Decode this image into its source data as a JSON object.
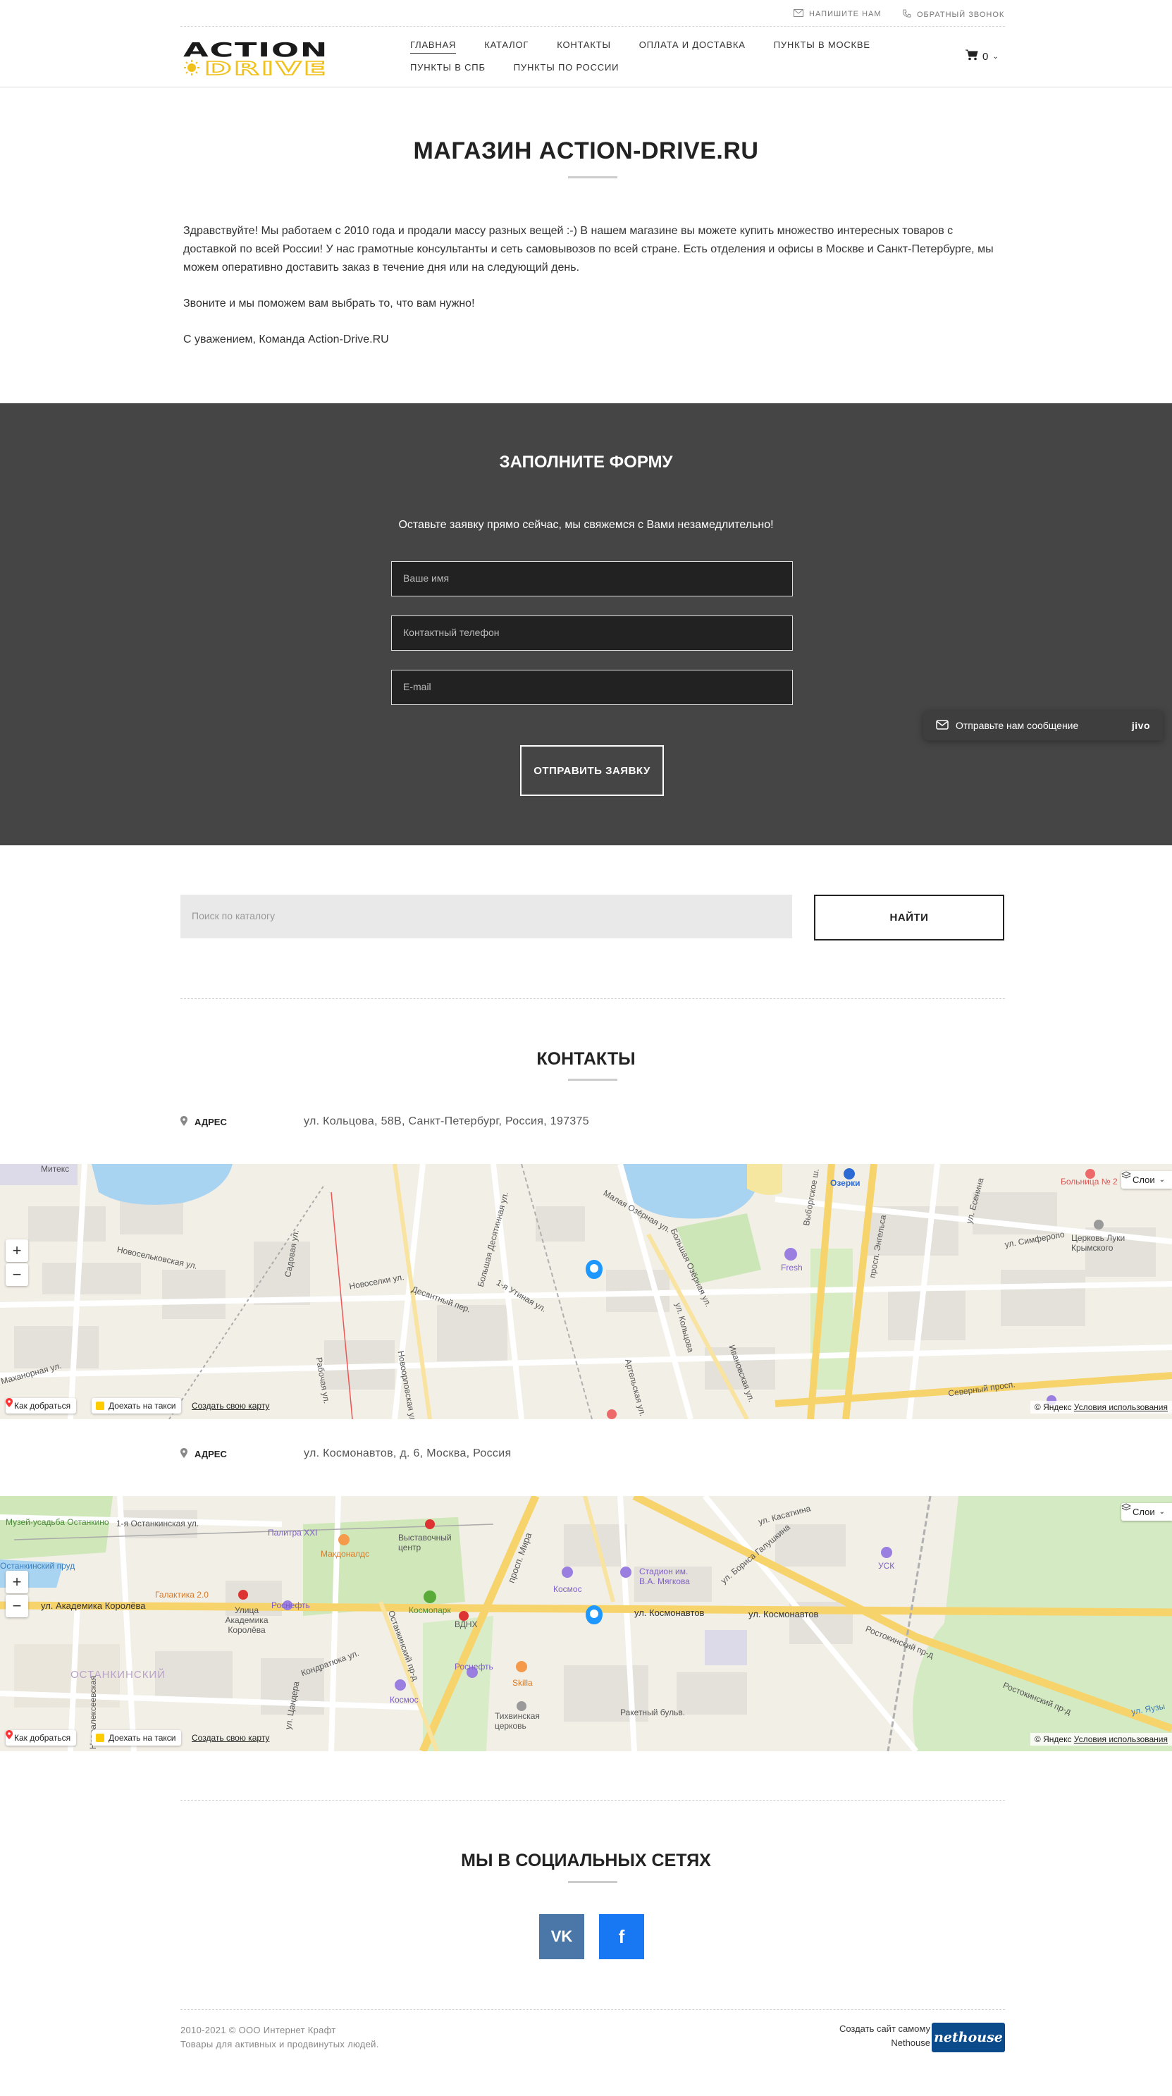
{
  "top_links": {
    "write_us": "НАПИШИТЕ НАМ",
    "callback": "ОБРАТНЫЙ ЗВОНОК"
  },
  "logo": {
    "line1": "ACTION",
    "line2": "DRIVE"
  },
  "nav": [
    {
      "label": "ГЛАВНАЯ",
      "active": true
    },
    {
      "label": "КАТАЛОГ"
    },
    {
      "label": "КОНТАКТЫ"
    },
    {
      "label": "ОПЛАТА И ДОСТАВКА"
    },
    {
      "label": "ПУНКТЫ В МОСКВЕ"
    },
    {
      "label": "ПУНКТЫ В СПБ"
    },
    {
      "label": "ПУНКТЫ ПО РОССИИ"
    }
  ],
  "cart": {
    "count": "0"
  },
  "store": {
    "title": "МАГАЗИН ACTION-DRIVE.RU",
    "paragraphs": [
      "Здравствуйте! Мы работаем с 2010 года и продали массу разных вещей :-) В нашем магазине вы можете купить множество интересных товаров с доставкой по всей России! У нас грамотные консультанты и сеть самовывозов по всей стране. Есть отделения и офисы в Москве и Санкт-Петербурге, мы можем оперативно доставить заказ в течение дня или на следующий день.",
      "Звоните и мы поможем вам выбрать то, что вам нужно!",
      "С уважением, Команда Action-Drive.RU"
    ]
  },
  "form": {
    "title": "ЗАПОЛНИТЕ ФОРМУ",
    "subtitle": "Оставьте заявку прямо сейчас, мы свяжемся с Вами незамедлительно!",
    "name_placeholder": "Ваше имя",
    "phone_placeholder": "Контактный телефон",
    "email_placeholder": "E-mail",
    "submit": "ОТПРАВИТЬ ЗАЯВКУ"
  },
  "chat_widget": {
    "text": "Отправьте нам сообщение",
    "brand": "jivo"
  },
  "search": {
    "placeholder": "Поиск по каталогу",
    "button": "НАЙТИ"
  },
  "contacts": {
    "title": "КОНТАКТЫ",
    "address_label": "АДРЕС",
    "address1": "ул. Кольцова, 58В,  Санкт-Петербург,  Россия,  197375",
    "address2": "ул. Космонавтов, д. 6,  Москва,  Россия"
  },
  "map_ui": {
    "route": "Как добраться",
    "taxi": "Доехать на такси",
    "create": "Создать свою карту",
    "layers": "Слои",
    "copyright": "© Яндекс",
    "terms": "Условия использования",
    "zoom_in": "+",
    "zoom_out": "−"
  },
  "map1_labels": {
    "l1": "Митекс",
    "l2": "Новосельковская ул.",
    "l3": "Садовая ул.",
    "l4": "Новоселки ул.",
    "l5": "Десантный пер.",
    "l6": "Большая Десятинная ул.",
    "l7": "Малая Озёрная ул.",
    "l8": "Большая Озёрная ул.",
    "l9": "ул. Кольцова",
    "l10": "Озерки",
    "l11": "просп. Энгельса",
    "l12": "Выборгское ш.",
    "l13": "Fresh",
    "l14": "Больница № 2",
    "l15": "ул. Симферопо",
    "l16": "Церковь Луки Крымского",
    "l17": "ул. Есенина",
    "l18": "Северный просп.",
    "l19": "Рабочая ул.",
    "l20": "Новоорловская ул.",
    "l21": "Ивановская ул.",
    "l22": "Артельская ул.",
    "l23": "1-я Утиная ул.",
    "l24": "Маханорная ул."
  },
  "map2_labels": {
    "m1": "Музей-усадьба Останкино",
    "m2": "1-я Останкинская ул.",
    "m3": "Останкинский пруд",
    "m4": "Галактика 2.0",
    "m5": "ул. Академика Королёва",
    "m6": "Улица Академика Королёва",
    "m7": "Роснефть",
    "m8": "Палитра XXI",
    "m9": "Макдоналдс",
    "m10": "Выставочный центр",
    "m11": "Космопарк",
    "m12": "ВДНХ",
    "m13": "просп. Мира",
    "m14": "Останкинский пр-д",
    "m15": "Роснефть",
    "m16": "Космос",
    "m17": "Skilla",
    "m18": "Тихвинская церковь",
    "m19": "Ракетный бульв.",
    "m20": "ОСТАНКИНСКИЙ",
    "m21": "Космос",
    "m22": "Стадион им. В.А. Мягкова",
    "m23": "ул. Космонавтов",
    "m24": "ул. Космонавтов",
    "m25": "ул. Бориса Галушкина",
    "m26": "ул. Касаткина",
    "m27": "УСК",
    "m28": "Ростокинский пр-д",
    "m29": "ул. Яузы",
    "m30": "ул. Цандера",
    "m31": "Кондратюка ул.",
    "m32": "Новоалексеевская",
    "m33": "Ростокинский пр-д"
  },
  "social": {
    "title": "МЫ В СОЦИАЛЬНЫХ СЕТЯХ",
    "vk": "VK",
    "fb": "f"
  },
  "footer": {
    "copyright": "2010-2021 © ООО Интернет Крафт",
    "tagline": "Товары для активных и продвинутых людей.",
    "create_site": "Создать сайт самому",
    "nethouse_text": "Nethouse",
    "nethouse_logo": "nethouse"
  },
  "colors": {
    "logo_yellow": "#f0c11a",
    "form_bg": "#454545",
    "vk": "#4a76a8",
    "fb": "#1877f2",
    "nethouse": "#0b4a8b"
  }
}
